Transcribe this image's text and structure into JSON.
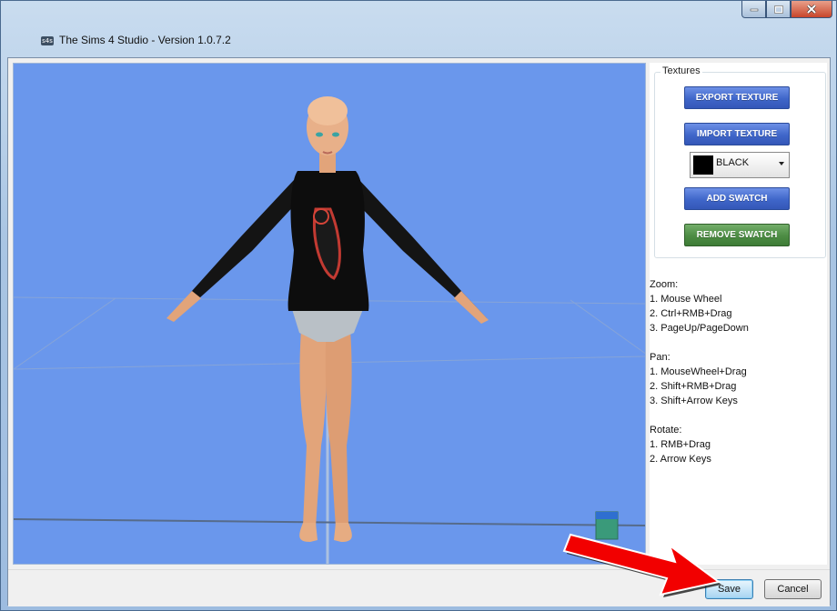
{
  "window": {
    "title": "The Sims 4 Studio - Version 1.0.7.2",
    "icon_text": "s4s",
    "icon": "s4s-app-icon",
    "caption_buttons": [
      "minimize-icon",
      "maximize-icon",
      "close-icon"
    ]
  },
  "textures": {
    "group_label": "Textures",
    "export_label": "EXPORT TEXTURE",
    "import_label": "IMPORT TEXTURE",
    "swatch": {
      "selected": "BLACK",
      "color": "#000000"
    },
    "add_swatch_label": "ADD SWATCH",
    "remove_swatch_label": "REMOVE SWATCH"
  },
  "help": {
    "zoom_title": "Zoom:",
    "zoom": [
      "1. Mouse Wheel",
      "2. Ctrl+RMB+Drag",
      "3. PageUp/PageDown"
    ],
    "pan_title": "Pan:",
    "pan": [
      "1. MouseWheel+Drag",
      "2. Shift+RMB+Drag",
      "3. Shift+Arrow Keys"
    ],
    "rotate_title": "Rotate:",
    "rotate": [
      "1. RMB+Drag",
      "2. Arrow Keys"
    ]
  },
  "dialog": {
    "save_label": "Save",
    "cancel_label": "Cancel"
  },
  "colors": {
    "viewport_bg": "#6a97ec",
    "button_blue": "#3f66c9",
    "button_green": "#4c8c43",
    "annotation_arrow": "#f20000"
  }
}
